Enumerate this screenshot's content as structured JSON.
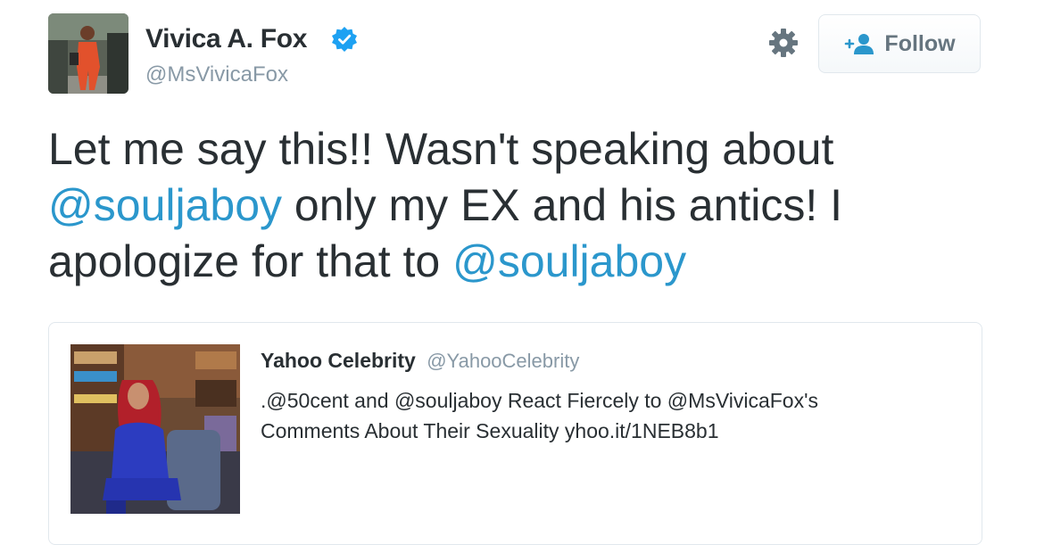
{
  "author": {
    "display_name": "Vivica A. Fox",
    "handle": "@MsVivicaFox",
    "verified": true,
    "avatar": "profile-photo"
  },
  "actions": {
    "settings_icon": "gear-icon",
    "follow_icon": "add-user-icon",
    "follow_label": "Follow"
  },
  "tweet": {
    "lines": [
      [
        {
          "text": "Let me say this!! Wasn't speaking about",
          "mention": false
        }
      ],
      [
        {
          "text": "@souljaboy",
          "mention": true
        },
        {
          "text": " only my EX and his antics! I",
          "mention": false
        }
      ],
      [
        {
          "text": "apologize for that to ",
          "mention": false
        },
        {
          "text": "@souljaboy",
          "mention": true
        }
      ]
    ]
  },
  "quote": {
    "name": "Yahoo Celebrity",
    "handle": "@YahooCelebrity",
    "text_lines": [
      ".@50cent and @souljaboy React Fiercely to @MsVivicaFox's",
      "Comments About Their Sexuality yhoo.it/1NEB8b1"
    ],
    "image": "talk-show-guest-photo"
  },
  "colors": {
    "link": "#2b97cc",
    "verified": "#1da1f2",
    "muted": "#8899a6",
    "text": "#292f33"
  }
}
